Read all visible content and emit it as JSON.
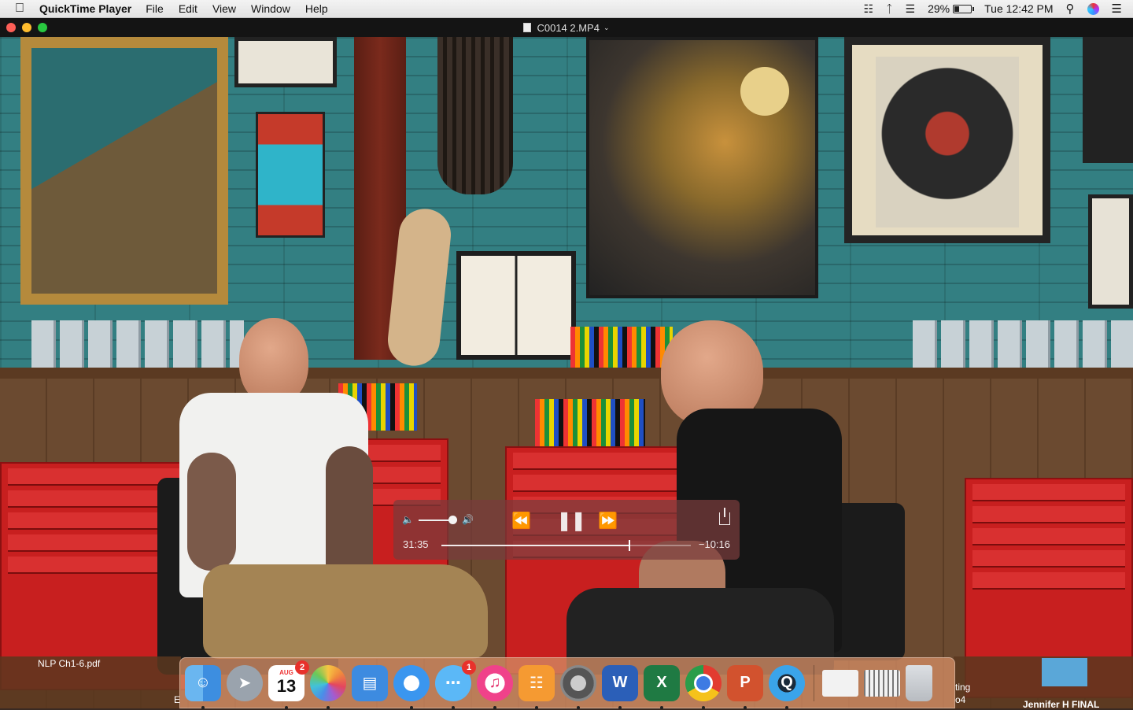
{
  "menubar": {
    "app_name": "QuickTime Player",
    "menus": [
      "File",
      "Edit",
      "View",
      "Window",
      "Help"
    ],
    "battery_percent": "29%",
    "battery_level": 0.29,
    "clock": "Tue 12:42 PM"
  },
  "window": {
    "title": "C0014 2.MP4"
  },
  "player": {
    "elapsed": "31:35",
    "remaining": "−10:16",
    "progress": 0.755,
    "volume": 0.9
  },
  "desktop": {
    "file_left": "NLP  Ch1-6.pdf",
    "file_left_tail": "E",
    "file_right_1": "ting",
    "file_right_2": "o4",
    "file_right_3": "Jennifer H  FINAL"
  },
  "dock": {
    "calendar_month": "AUG",
    "calendar_day": "13",
    "calendar_badge": "2",
    "messages_badge": "1"
  },
  "colors": {
    "menubar_bg": "#e8e8e8",
    "titlebar_bg": "#141414",
    "hud_bg": "#7a3c3c",
    "dock_bg": "#d28c64"
  }
}
